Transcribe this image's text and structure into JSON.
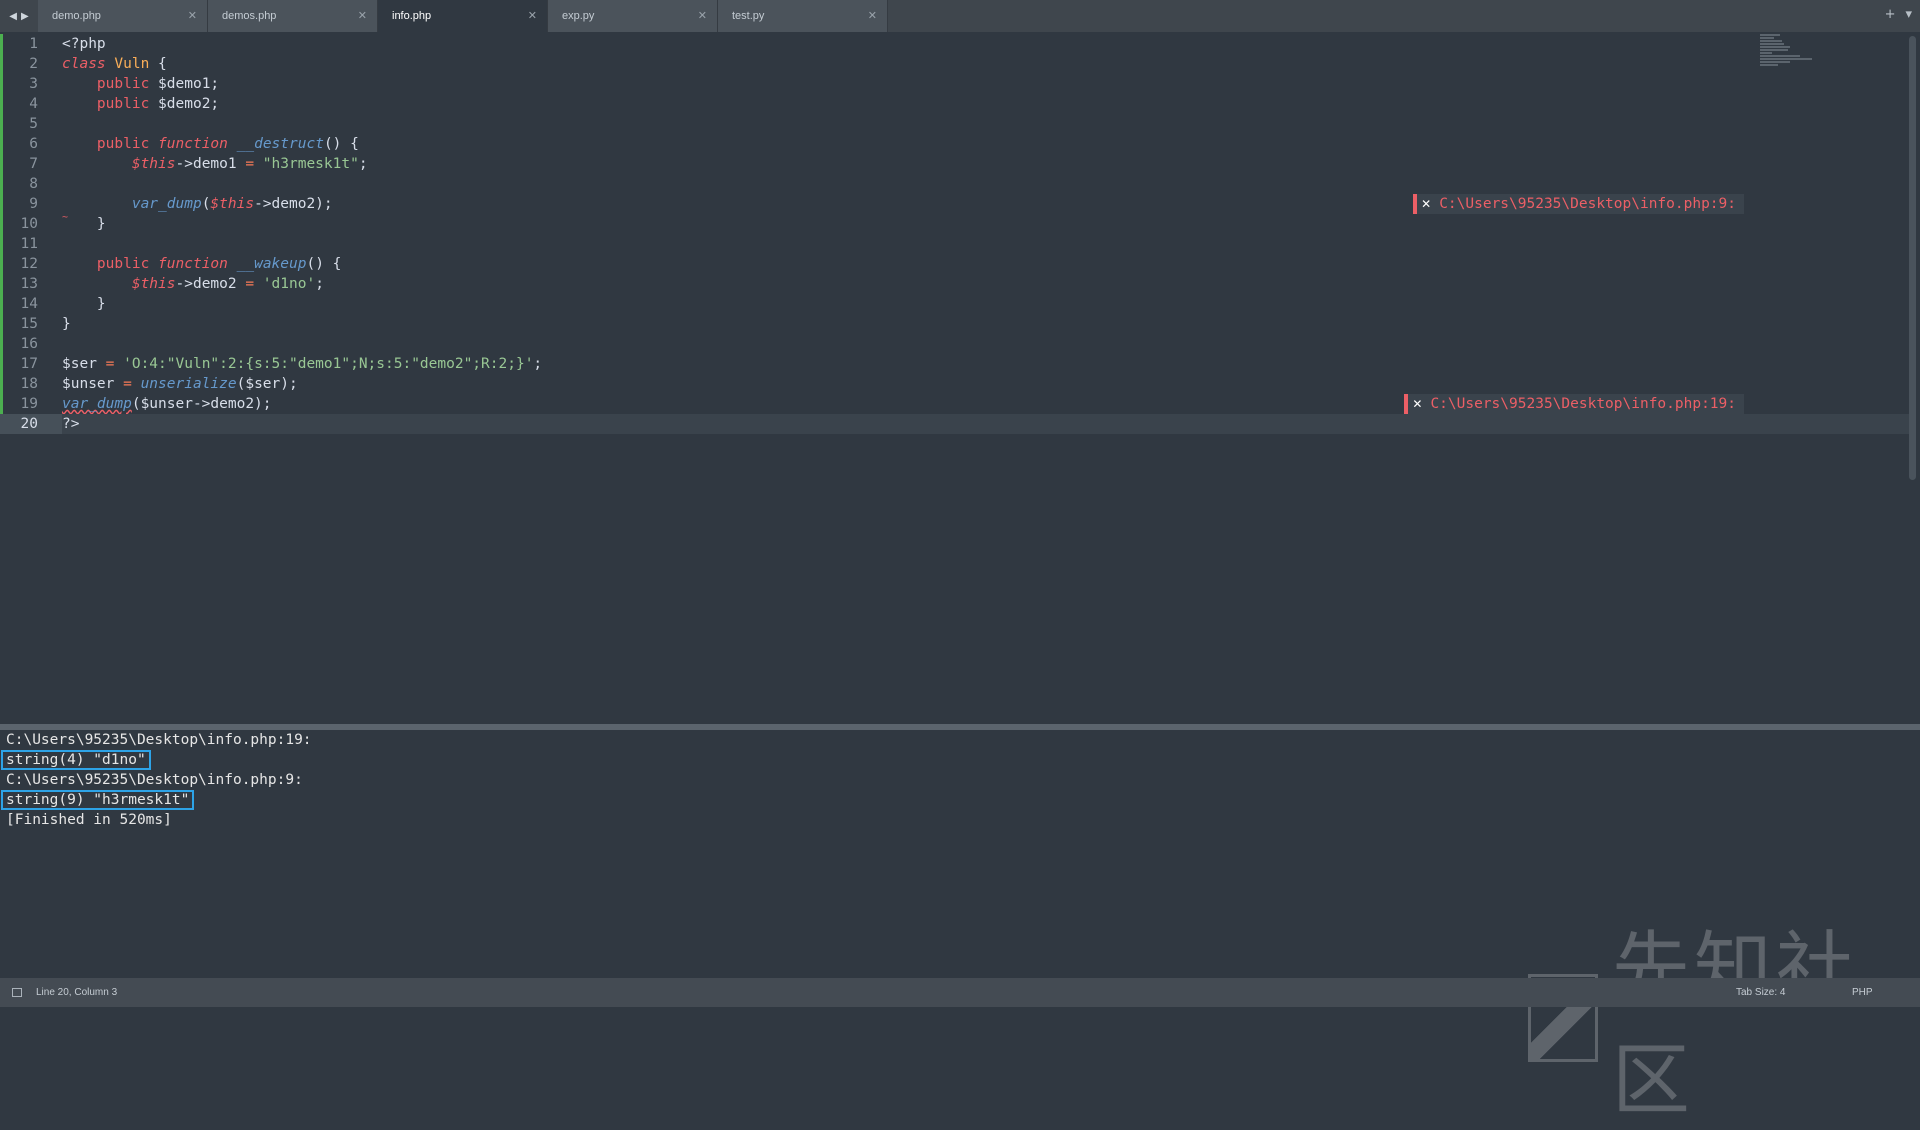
{
  "tabs": [
    {
      "label": "demo.php",
      "active": false
    },
    {
      "label": "demos.php",
      "active": false
    },
    {
      "label": "info.php",
      "active": true
    },
    {
      "label": "exp.py",
      "active": false
    },
    {
      "label": "test.py",
      "active": false
    }
  ],
  "tab_nav": {
    "back": "◀",
    "forward": "▶"
  },
  "tab_controls": {
    "add": "+",
    "menu": "▾"
  },
  "tab_close": "✕",
  "code": {
    "line_numbers": [
      "1",
      "2",
      "3",
      "4",
      "5",
      "6",
      "7",
      "8",
      "9",
      "10",
      "11",
      "12",
      "13",
      "14",
      "15",
      "16",
      "17",
      "18",
      "19",
      "20"
    ],
    "l1": "<?php",
    "l2_kw": "class",
    "l2_name": "Vuln",
    "l2_rest": " {",
    "l3_kw": "public",
    "l3_var": " $demo1;",
    "l4_kw": "public",
    "l4_var": " $demo2;",
    "l6_kw": "public",
    "l6_kw2": "function",
    "l6_fn": "__destruct",
    "l6_rest": "() {",
    "l7_this": "$this",
    "l7_rest": "->demo1 ",
    "l7_op": "=",
    "l7_str": " \"h3rmesk1t\"",
    "l7_end": ";",
    "l9_fn": "var_dump",
    "l9_open": "(",
    "l9_this": "$this",
    "l9_rest": "->demo2);",
    "l10": "}",
    "l12_kw": "public",
    "l12_kw2": "function",
    "l12_fn": "__wakeup",
    "l12_rest": "() {",
    "l13_this": "$this",
    "l13_rest": "->demo2 ",
    "l13_op": "=",
    "l13_str": " 'd1no'",
    "l13_end": ";",
    "l14": "}",
    "l15": "}",
    "l17_var": "$ser ",
    "l17_op": "=",
    "l17_str": " 'O:4:\"Vuln\":2:{s:5:\"demo1\";N;s:5:\"demo2\";R:2;}'",
    "l17_end": ";",
    "l18_var": "$unser ",
    "l18_op": "=",
    "l18_fn": " unserialize",
    "l18_rest": "($ser);",
    "l19_fn": "var_dump",
    "l19_rest": "($unser->demo2);",
    "l20": "?>"
  },
  "phantoms": {
    "line9": "C:\\Users\\95235\\Desktop\\info.php:9:",
    "line19": "C:\\Users\\95235\\Desktop\\info.php:19:",
    "close": "✕"
  },
  "output": [
    "C:\\Users\\95235\\Desktop\\info.php:19:",
    "string(4) \"d1no\"",
    "C:\\Users\\95235\\Desktop\\info.php:9:",
    "string(9) \"h3rmesk1t\"",
    "[Finished in 520ms]"
  ],
  "status": {
    "position": "Line 20, Column 3",
    "tab_size": "Tab Size: 4",
    "syntax": "PHP"
  },
  "watermark": {
    "text": "先知社区"
  },
  "colors": {
    "accent_box": "#2da3e7",
    "error": "#ec5f66",
    "background": "#303841"
  }
}
